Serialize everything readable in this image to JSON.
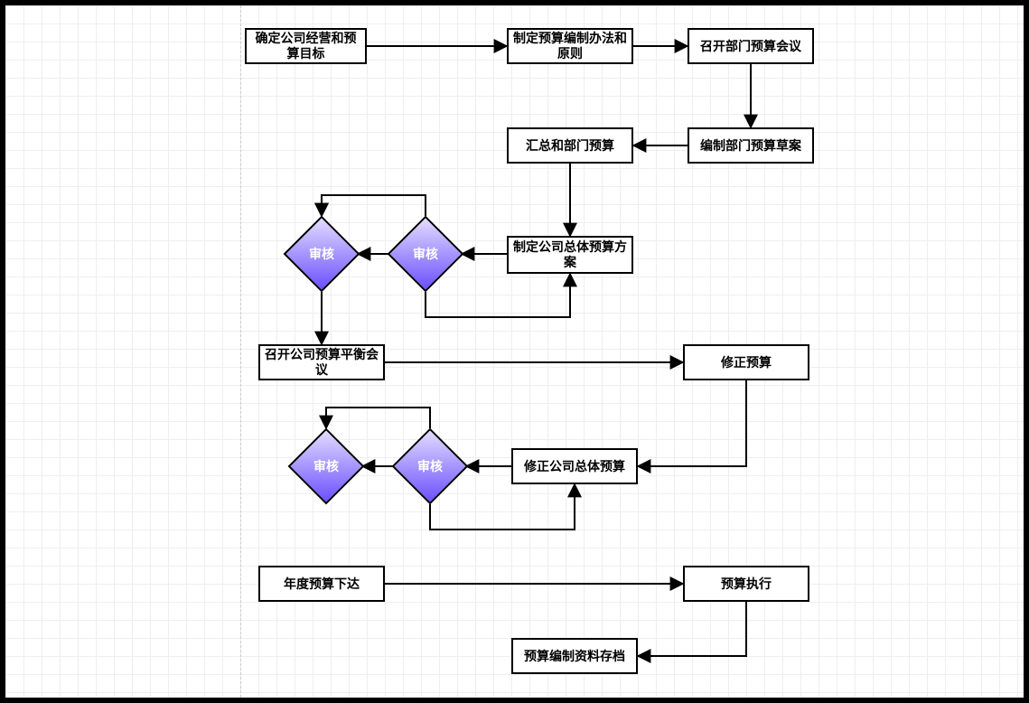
{
  "nodes": {
    "n1": "确定公司经营和预算目标",
    "n2": "制定预算编制办法和原则",
    "n3": "召开部门预算会议",
    "n4": "编制部门预算草案",
    "n5": "汇总和部门预算",
    "n6": "制定公司总体预算方案",
    "n7": "审核",
    "n8": "审核",
    "n9": "召开公司预算平衡会议",
    "n10": "修正预算",
    "n11": "修正公司总体预算",
    "n12": "审核",
    "n13": "审核",
    "n14": "年度预算下达",
    "n15": "预算执行",
    "n16": "预算编制资料存档"
  }
}
